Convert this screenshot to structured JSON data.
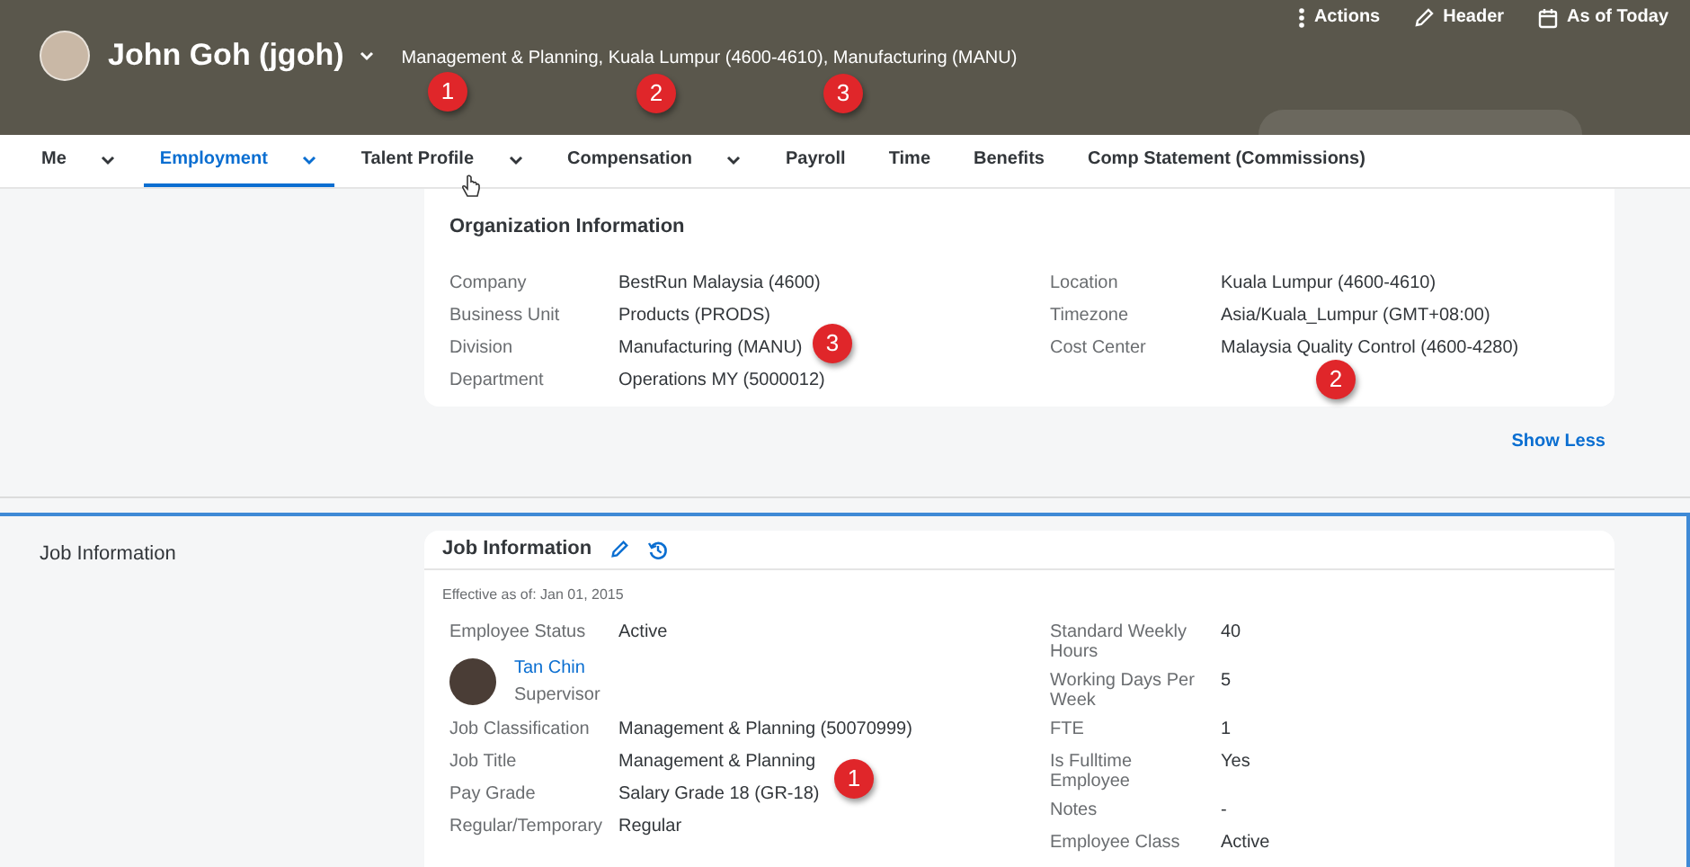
{
  "header": {
    "name": "John Goh (jgoh)",
    "subtitle": "Management & Planning, Kuala Lumpur (4600-4610), Manufacturing (MANU)",
    "actions": [
      {
        "kind": "more",
        "label": "Actions"
      },
      {
        "kind": "edit",
        "label": "Header"
      },
      {
        "kind": "calendar",
        "label": "As of Today"
      }
    ]
  },
  "tabs": [
    {
      "label": "Me",
      "has_menu": true,
      "selected": false
    },
    {
      "label": "Employment",
      "has_menu": true,
      "selected": true
    },
    {
      "label": "Talent Profile",
      "has_menu": true,
      "selected": false
    },
    {
      "label": "Compensation",
      "has_menu": true,
      "selected": false
    },
    {
      "label": "Payroll",
      "has_menu": false,
      "selected": false
    },
    {
      "label": "Time",
      "has_menu": false,
      "selected": false
    },
    {
      "label": "Benefits",
      "has_menu": false,
      "selected": false
    },
    {
      "label": "Comp Statement (Commissions)",
      "has_menu": false,
      "selected": false
    }
  ],
  "org_card": {
    "title": "Organization Information",
    "left": [
      {
        "label": "Company",
        "value": "BestRun Malaysia (4600)"
      },
      {
        "label": "Business Unit",
        "value": "Products (PRODS)"
      },
      {
        "label": "Division",
        "value": "Manufacturing (MANU)"
      },
      {
        "label": "Department",
        "value": "Operations MY (5000012)"
      }
    ],
    "right": [
      {
        "label": "Location",
        "value": "Kuala Lumpur (4600-4610)"
      },
      {
        "label": "Timezone",
        "value": "Asia/Kuala_Lumpur (GMT+08:00)"
      },
      {
        "label": "Cost Center",
        "value": "Malaysia Quality Control (4600-4280)"
      }
    ]
  },
  "show_less": "Show Less",
  "section_label": "Job Information",
  "job_card": {
    "title": "Job Information",
    "effective": "Effective as of: Jan 01, 2015",
    "left": [
      {
        "kind": "field",
        "label": "Employee Status",
        "value": "Active"
      },
      {
        "kind": "person",
        "name": "Tan Chin",
        "role": "Supervisor"
      },
      {
        "kind": "field",
        "label": "Job Classification",
        "value": "Management & Planning (50070999)"
      },
      {
        "kind": "field",
        "label": "Job Title",
        "value": "Management & Planning"
      },
      {
        "kind": "field",
        "label": "Pay Grade",
        "value": "Salary Grade 18 (GR-18)"
      },
      {
        "kind": "field",
        "label": "Regular/Temporary",
        "value": "Regular"
      }
    ],
    "right": [
      {
        "kind": "field",
        "label": "Standard Weekly Hours",
        "value": "40"
      },
      {
        "kind": "field",
        "label": "Working Days Per Week",
        "value": "5"
      },
      {
        "kind": "field",
        "label": "FTE",
        "value": "1"
      },
      {
        "kind": "field",
        "label": "Is Fulltime Employee",
        "value": "Yes"
      },
      {
        "kind": "field",
        "label": "Notes",
        "value": "-"
      },
      {
        "kind": "field",
        "label": "Employee Class",
        "value": "Active"
      }
    ]
  },
  "callouts": [
    "1",
    "2",
    "3",
    "3",
    "2",
    "1"
  ]
}
